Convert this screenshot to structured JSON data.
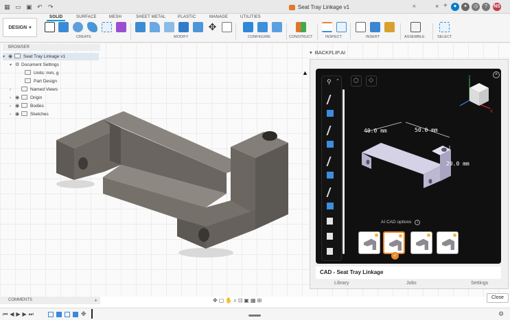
{
  "window": {
    "title": "Seat Tray Linkage v1"
  },
  "ribbon": {
    "workspace": "DESIGN",
    "tabs": [
      "SOLID",
      "SURFACE",
      "MESH",
      "SHEET METAL",
      "PLASTIC",
      "MANAGE",
      "UTILITIES"
    ],
    "active_tab": "SOLID",
    "groups": [
      "CREATE",
      "MODIFY",
      "CONFIGURE",
      "CONSTRUCT",
      "INSPECT",
      "INSERT",
      "ASSEMBLE",
      "SELECT"
    ]
  },
  "browser": {
    "header": "BROWSER",
    "root": "Seat Tray Linkage v1",
    "items": [
      {
        "label": "Document Settings"
      },
      {
        "label": "Units: mm, g"
      },
      {
        "label": "Part Design"
      },
      {
        "label": "Named Views"
      },
      {
        "label": "Origin"
      },
      {
        "label": "Bodies"
      },
      {
        "label": "Sketches"
      }
    ]
  },
  "panel": {
    "title": "BACKFLIP.AI",
    "dims": {
      "a": "40.0 mm",
      "b": "50.0 mm",
      "c": "20.0 mm"
    },
    "options_label": "AI CAD options",
    "caption": "CAD - Seat Tray Linkage",
    "tabs": [
      "Library",
      "Jobs",
      "Settings"
    ],
    "close": "Close"
  },
  "comments": {
    "label": "COMMENTS"
  },
  "user": {
    "initials": "NS"
  },
  "colors": {
    "accent": "#0696d7",
    "highlight": "#e8892a"
  }
}
